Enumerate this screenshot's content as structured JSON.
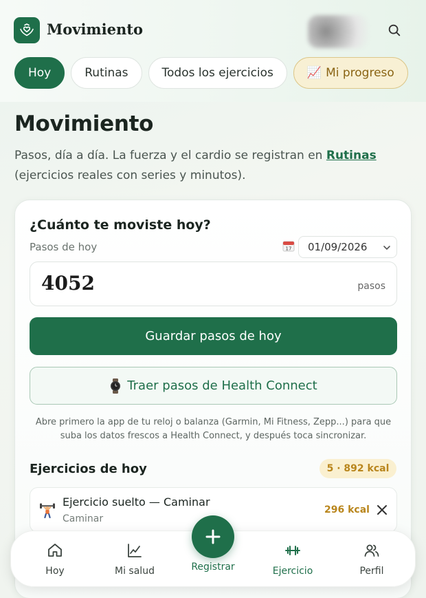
{
  "header": {
    "brand": "Movimiento",
    "icons": {
      "logo": "heart-hands-icon",
      "search": "search-icon"
    },
    "colors": {
      "brand_green": "#1f6f4a"
    }
  },
  "tabs": [
    {
      "label": "Hoy",
      "active": true
    },
    {
      "label": "Rutinas",
      "active": false
    },
    {
      "label": "Todos los ejercicios",
      "active": false
    },
    {
      "label": "Mi progreso",
      "icon": "📈",
      "active": false
    }
  ],
  "intro": {
    "title": "Movimiento",
    "text_before": "Pasos, día a día. La fuerza y el cardio se registran en ",
    "link": "Rutinas",
    "text_after": " (ejercicios reales con series y minutos)."
  },
  "steps_card": {
    "title": "¿Cuánto te moviste hoy?",
    "steps_label": "Pasos de hoy",
    "date_icon": "📅",
    "date": "01/09/2026",
    "steps_value": "4052",
    "steps_unit": "pasos",
    "save_button": "Guardar pasos de hoy",
    "health_connect_icon": "⌚",
    "health_connect_button": "Traer pasos de Health Connect",
    "help_text": "Abre primero la app de tu reloj o balanza (Garmin, Mi Fitness, Zepp...) para que suba los datos frescos a Health Connect, y después toca sincronizar."
  },
  "exercises": {
    "title": "Ejercicios de hoy",
    "total_badge": "5 · 892 kcal",
    "items": [
      {
        "icon": "🏋️",
        "name": "Ejercicio suelto — Caminar",
        "subtitle": "Caminar",
        "kcal": "296 kcal"
      }
    ]
  },
  "bottom_nav": {
    "items": [
      {
        "label": "Hoy",
        "icon": "home-icon"
      },
      {
        "label": "Mi salud",
        "icon": "chart-line-icon"
      },
      {
        "label": "Registrar",
        "icon": "plus-icon"
      },
      {
        "label": "Ejercicio",
        "icon": "dumbbell-icon",
        "active": true
      },
      {
        "label": "Perfil",
        "icon": "users-icon"
      }
    ]
  }
}
